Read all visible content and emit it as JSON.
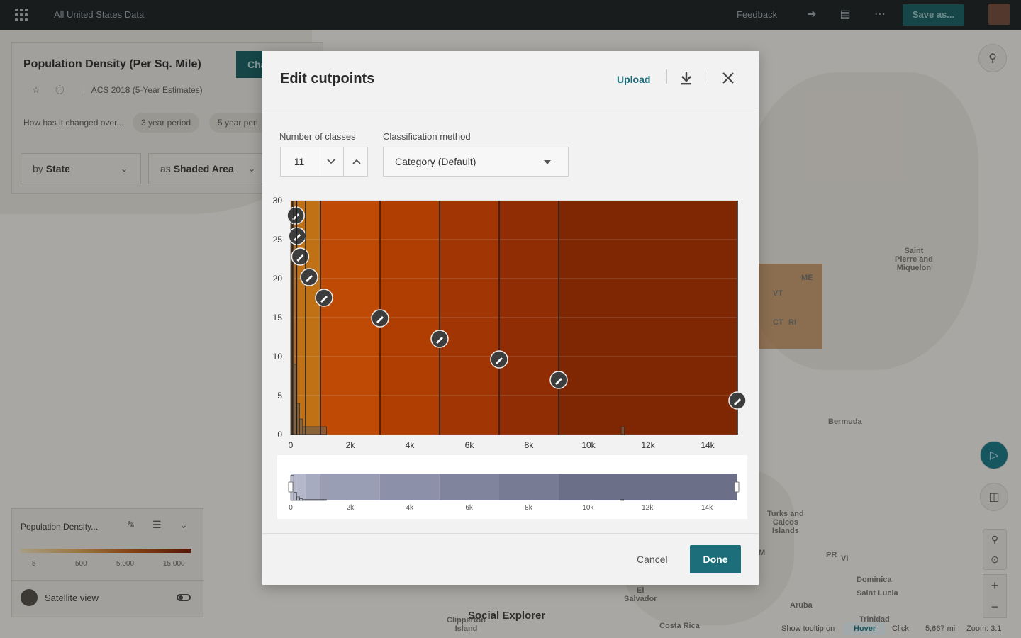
{
  "topbar": {
    "title": "All United States Data",
    "feedback": "Feedback",
    "save_as": "Save as..."
  },
  "left_panel": {
    "title": "Population Density (Per Sq. Mile)",
    "change_button": "Cha",
    "dataset": "ACS 2018 (5-Year Estimates)",
    "changed_question": "How has it changed over...",
    "period_chips": [
      "3 year period",
      "5 year peri"
    ],
    "by_prefix": "by",
    "by_value": "State",
    "as_prefix": "as",
    "as_value": "Shaded Area"
  },
  "legend_panel": {
    "title": "Population Density...",
    "ticks": [
      "5",
      "500",
      "5,000",
      "15,000"
    ],
    "satellite_label": "Satellite view"
  },
  "map_labels": [
    {
      "text": "Saint\nPierre and\nMiquelon"
    },
    {
      "text": "ME"
    },
    {
      "text": "VT"
    },
    {
      "text": "CT"
    },
    {
      "text": "RI"
    },
    {
      "text": "Bermuda"
    },
    {
      "text": "Turks and\nCaicos\nIslands"
    },
    {
      "text": "PR"
    },
    {
      "text": "VI"
    },
    {
      "text": "Dominica"
    },
    {
      "text": "Saint Lucia"
    },
    {
      "text": "El\nSalvador"
    },
    {
      "text": "Clipperton\nIsland"
    },
    {
      "text": "Aruba"
    },
    {
      "text": "Costa Rica"
    },
    {
      "text": "M"
    },
    {
      "text": "Trinidad"
    }
  ],
  "brand": "Social Explorer",
  "status_bar": {
    "tooltip_label": "Show tooltip on",
    "hover": "Hover",
    "click": "Click",
    "distance": "5,667 mi",
    "zoom": "Zoom: 3.1"
  },
  "modal": {
    "title": "Edit cutpoints",
    "upload": "Upload",
    "classes_label": "Number of classes",
    "classes_value": "11",
    "method_label": "Classification method",
    "method_value": "Category (Default)",
    "cancel": "Cancel",
    "done": "Done"
  },
  "colors": {
    "accent": "#1c6f7a",
    "class_fills": [
      "#b8691a",
      "#c07015",
      "#bf4a06",
      "#b03e02",
      "#a13604",
      "#902d04",
      "#7f2602"
    ]
  },
  "chart_data": {
    "type": "histogram",
    "ylim": [
      0,
      30
    ],
    "xlim": [
      0,
      15000
    ],
    "y_ticks": [
      "0",
      "5",
      "10",
      "15",
      "20",
      "25",
      "30"
    ],
    "x_ticks": [
      "0",
      "2k",
      "4k",
      "6k",
      "8k",
      "10k",
      "12k",
      "14k"
    ],
    "x_tick_values": [
      0,
      2000,
      4000,
      6000,
      8000,
      10000,
      12000,
      14000
    ],
    "cutpoints": [
      50,
      100,
      200,
      500,
      1000,
      3000,
      5000,
      7000,
      9000,
      15000
    ],
    "histogram_bins": [
      {
        "x0": 0,
        "x1": 100,
        "count": 28
      },
      {
        "x0": 100,
        "x1": 200,
        "count": 9
      },
      {
        "x0": 200,
        "x1": 300,
        "count": 4
      },
      {
        "x0": 300,
        "x1": 400,
        "count": 2
      },
      {
        "x0": 400,
        "x1": 500,
        "count": 1
      },
      {
        "x0": 500,
        "x1": 1200,
        "count": 1
      },
      {
        "x0": 11100,
        "x1": 11200,
        "count": 1
      }
    ],
    "range_slider": {
      "min": 0,
      "max": 15000
    }
  }
}
